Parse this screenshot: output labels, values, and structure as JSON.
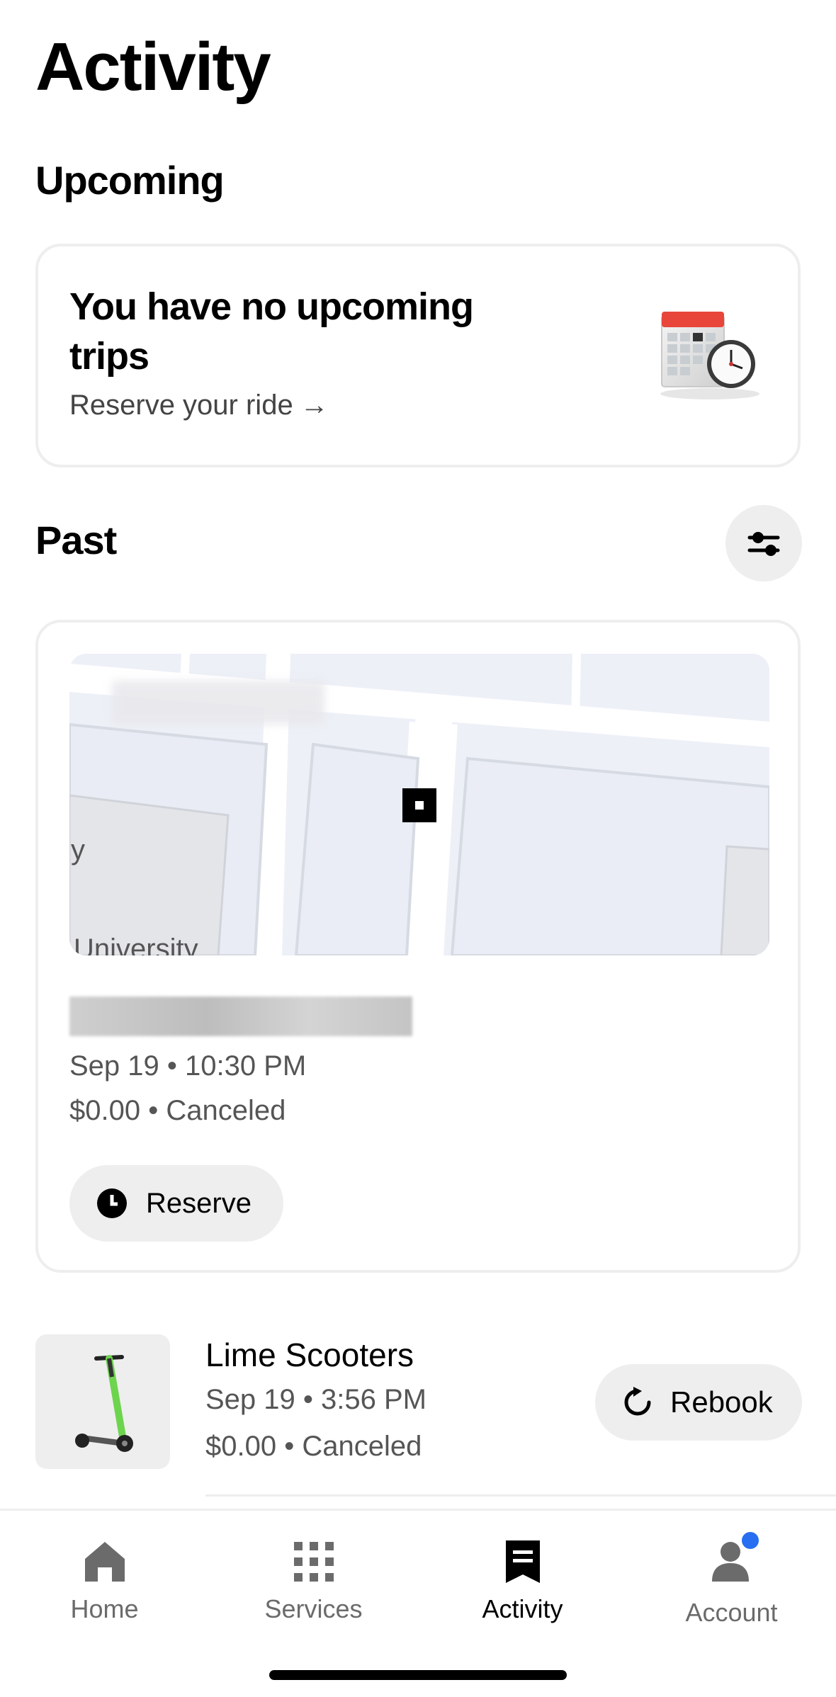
{
  "header": {
    "title": "Activity"
  },
  "upcoming": {
    "section_title": "Upcoming",
    "heading": "You have no upcoming trips",
    "link_label": "Reserve your ride",
    "link_arrow": "→",
    "illustration": "calendar-clock"
  },
  "past": {
    "section_title": "Past",
    "filter_icon": "filter-sliders-icon",
    "trips": [
      {
        "map_labels": [
          "y",
          "University"
        ],
        "datetime": "Sep 19 • 10:30 PM",
        "status": "$0.00 • Canceled",
        "action_label": "Reserve",
        "action_icon": "clock-icon"
      },
      {
        "title": "Lime Scooters",
        "datetime": "Sep 19 • 3:56 PM",
        "status": "$0.00 • Canceled",
        "action_label": "Rebook",
        "action_icon": "refresh-icon",
        "thumbnail": "scooter-image"
      }
    ]
  },
  "bottom_nav": {
    "items": [
      {
        "label": "Home",
        "icon": "home-icon",
        "active": false
      },
      {
        "label": "Services",
        "icon": "grid-icon",
        "active": false
      },
      {
        "label": "Activity",
        "icon": "receipt-icon",
        "active": true
      },
      {
        "label": "Account",
        "icon": "person-icon",
        "active": false,
        "notification_dot": true
      }
    ]
  },
  "colors": {
    "accent_dot": "#276EF1",
    "surface": "#EEEEEE",
    "lime_green": "#6DD44E"
  }
}
